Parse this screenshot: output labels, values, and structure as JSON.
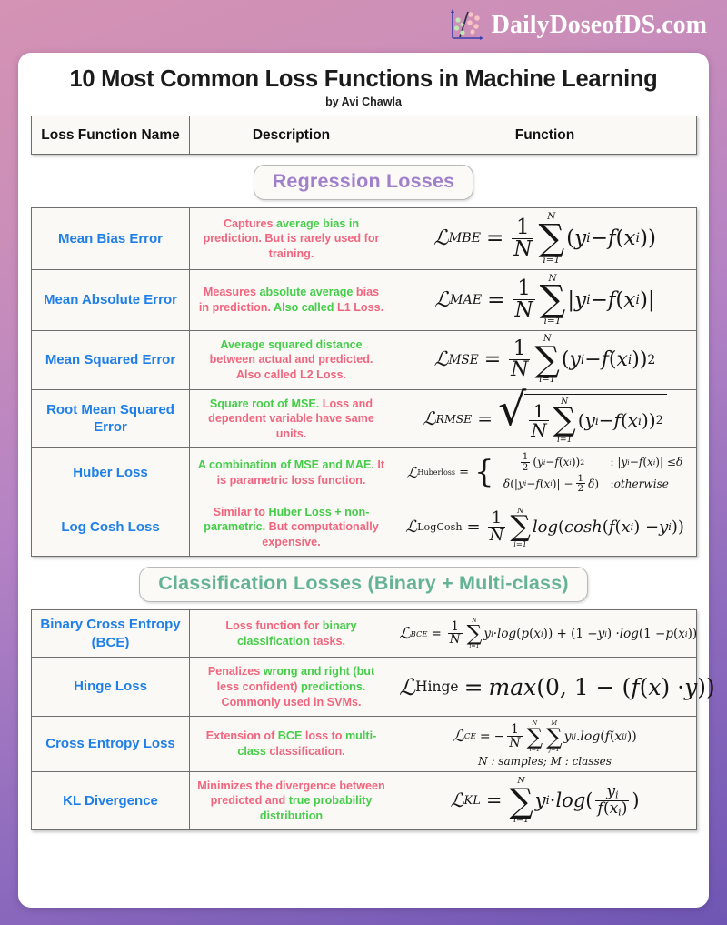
{
  "brand": {
    "name": "DailyDoseofDS.com",
    "logo_icon": "scatter-plot-logo-icon"
  },
  "header": {
    "title": "10 Most Common Loss Functions in Machine Learning",
    "byline": "by Avi Chawla"
  },
  "table": {
    "columns": [
      "Loss Function Name",
      "Description",
      "Function"
    ]
  },
  "sections": [
    {
      "id": "regression",
      "label": "Regression Losses",
      "color": "#a07fcb",
      "rows": [
        {
          "name": "Mean Bias Error",
          "description": "Captures average bias in prediction. But is rarely used for training.",
          "formula": "L_MBE = (1/N) sum_{i=1}^{N} (y_i - f(x_i))"
        },
        {
          "name": "Mean Absolute Error",
          "description": "Measures absolute average bias in prediction. Also called L1 Loss.",
          "formula": "L_MAE = (1/N) sum_{i=1}^{N} |y_i - f(x_i)|"
        },
        {
          "name": "Mean Squared Error",
          "description": "Average squared distance between actual and predicted. Also called L2 Loss.",
          "formula": "L_MSE = (1/N) sum_{i=1}^{N} (y_i - f(x_i))^2"
        },
        {
          "name": "Root Mean Squared Error",
          "description": "Square root of MSE. Loss and dependent variable have same units.",
          "formula": "L_RMSE = sqrt( (1/N) sum_{i=1}^{N} (y_i - f(x_i))^2 )"
        },
        {
          "name": "Huber Loss",
          "description": "A combination of MSE and MAE. It is parametric loss function.",
          "formula": "L_Huberloss = { 1/2 (y_i - f(x_i))^2 : |y_i - f(x_i)| <= delta ; delta(|y_i - f(x_i)| - 1/2 delta) : otherwise }"
        },
        {
          "name": "Log Cosh Loss",
          "description": "Similar to Huber Loss + non-parametric. But computationally expensive.",
          "formula": "L_LogCosh = (1/N) sum_{i=1}^{N} log(cosh(f(x_i) - y_i))"
        }
      ]
    },
    {
      "id": "classification",
      "label": "Classification Losses (Binary + Multi-class)",
      "color": "#64b393",
      "rows": [
        {
          "name": "Binary Cross Entropy (BCE)",
          "description": "Loss function for binary classification tasks.",
          "formula": "L_BCE = (1/N) sum_{i=1}^{N} y_i . log(p(x_i)) + (1 - y_i) . log(1 - p(x_i))"
        },
        {
          "name": "Hinge Loss",
          "description": "Penalizes wrong and right (but less confident) predictions. Commonly used in SVMs.",
          "formula": "L_Hinge = max(0, 1 - (f(x) . y))"
        },
        {
          "name": "Cross Entropy Loss",
          "description": "Extension of BCE loss to multi-class classification.",
          "formula": "L_CE = -(1/N) sum_{i=1}^{N} sum_{j=1}^{M} y_ij.log(f(x_ij))",
          "formula_note": "N : samples; M : classes"
        },
        {
          "name": "KL Divergence",
          "description": "Minimizes the divergence between predicted and true probability distribution",
          "formula": "L_KL = sum_{i=1}^{N} y_i . log( y_i / f(x_i) )"
        }
      ]
    }
  ],
  "styles": {
    "name_color": "#1f7fe8",
    "desc_pink": "#f2657f",
    "desc_green": "#45cd4a",
    "background_top": "#d492b4",
    "background_bottom": "#6f56b4"
  }
}
